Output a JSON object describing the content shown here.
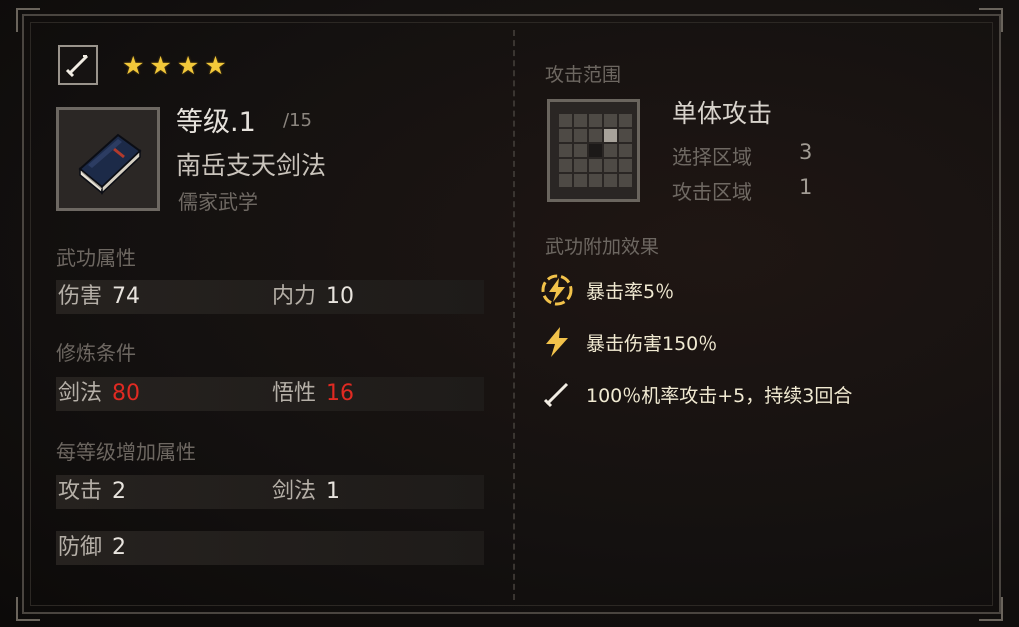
{
  "left": {
    "stars": 4,
    "level_text": "等级.1",
    "level_max": "/15",
    "skill_name": "南岳支天剑法",
    "school": "儒家武学",
    "sections": {
      "attributes": "武功属性",
      "requirements": "修炼条件",
      "per_level": "每等级增加属性"
    },
    "attributes": [
      {
        "label": "伤害",
        "value": "74"
      },
      {
        "label": "内力",
        "value": "10"
      }
    ],
    "requirements": [
      {
        "label": "剑法",
        "value": "80"
      },
      {
        "label": "悟性",
        "value": "16"
      }
    ],
    "per_level": [
      {
        "label": "攻击",
        "value": "2"
      },
      {
        "label": "剑法",
        "value": "1"
      },
      {
        "label": "防御",
        "value": "2"
      }
    ]
  },
  "right": {
    "range_title": "攻击范围",
    "attack_type": "单体攻击",
    "select_area_label": "选择区域",
    "select_area_value": "3",
    "attack_area_label": "攻击区域",
    "attack_area_value": "1",
    "effects_title": "武功附加效果",
    "effects": [
      {
        "icon": "lightning-circle-icon",
        "text": "暴击率5％"
      },
      {
        "icon": "lightning-icon",
        "text": "暴击伤害150％"
      },
      {
        "icon": "sword-icon",
        "text": "100％机率攻击+5，持续3回合"
      }
    ]
  },
  "colors": {
    "star": "#f2c83a",
    "requirement_value": "#e02a22",
    "effect_icon": "#f2c24a"
  }
}
